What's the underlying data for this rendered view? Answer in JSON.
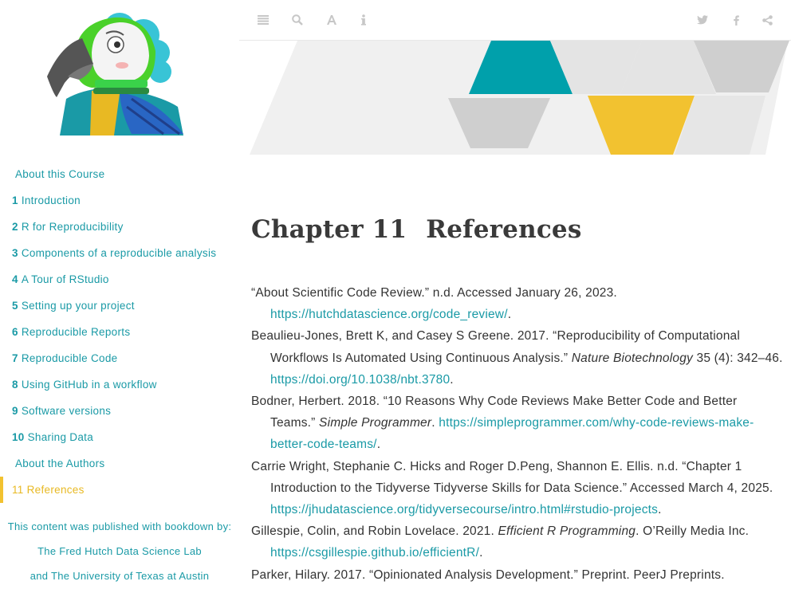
{
  "sidebar": {
    "items": [
      {
        "num": "",
        "label": "About this Course"
      },
      {
        "num": "1",
        "label": "Introduction"
      },
      {
        "num": "2",
        "label": "R for Reproducibility"
      },
      {
        "num": "3",
        "label": "Components of a reproducible analysis"
      },
      {
        "num": "4",
        "label": "A Tour of RStudio"
      },
      {
        "num": "5",
        "label": "Setting up your project"
      },
      {
        "num": "6",
        "label": "Reproducible Reports"
      },
      {
        "num": "7",
        "label": "Reproducible Code"
      },
      {
        "num": "8",
        "label": "Using GitHub in a workflow"
      },
      {
        "num": "9",
        "label": "Software versions"
      },
      {
        "num": "10",
        "label": "Sharing Data"
      },
      {
        "num": "",
        "label": "About the Authors"
      },
      {
        "num": "11",
        "label": "References"
      }
    ],
    "active_index": 12,
    "published": {
      "line1": "This content was published with bookdown by:",
      "line2": "The Fred Hutch Data Science Lab",
      "line3": "and The University of Texas at Austin"
    }
  },
  "toolbar": {
    "left_icons": [
      "toc-toggle-icon",
      "search-icon",
      "font-icon",
      "info-icon"
    ],
    "right_icons": [
      "twitter-icon",
      "facebook-icon",
      "share-icon"
    ]
  },
  "chapter": {
    "number": "Chapter 11",
    "title": "References"
  },
  "references": [
    {
      "text": "“About Scientific Code Review.” n.d. Accessed January 26, 2023. ",
      "italic": "",
      "after": "",
      "link": "https://hutchdatascience.org/code_review/",
      "end": "."
    },
    {
      "text": "Beaulieu-Jones, Brett K, and Casey S Greene. 2017. “Reproducibility of Computational Workflows Is Automated Using Continuous Analysis.” ",
      "italic": "Nature Biotechnology",
      "after": " 35 (4): 342–46. ",
      "link": "https://doi.org/10.1038/nbt.3780",
      "end": "."
    },
    {
      "text": "Bodner, Herbert. 2018. “10 Reasons Why Code Reviews Make Better Code and Better Teams.” ",
      "italic": "Simple Programmer",
      "after": ". ",
      "link": "https://simpleprogrammer.com/why-code-reviews-make-better-code-teams/",
      "end": "."
    },
    {
      "text": "Carrie Wright, Stephanie C. Hicks and Roger D.Peng, Shannon E. Ellis. n.d. “Chapter 1 Introduction to the Tidyverse Tidyverse Skills for Data Science.” Accessed March 4, 2025. ",
      "italic": "",
      "after": "",
      "link": "https://jhudatascience.org/tidyversecourse/intro.html#rstudio-projects",
      "end": "."
    },
    {
      "text": "Gillespie, Colin, and Robin Lovelace. 2021. ",
      "italic": "Efficient R Programming",
      "after": ". O’Reilly Media Inc. ",
      "link": "https://csgillespie.github.io/efficientR/",
      "end": "."
    },
    {
      "text": "Parker, Hilary. 2017. “Opinionated Analysis Development.” Preprint. PeerJ Preprints. ",
      "italic": "",
      "after": "",
      "link": "",
      "end": ""
    }
  ],
  "colors": {
    "accent_teal": "#1a9aa6",
    "accent_yellow": "#f2c230",
    "banner_gray": "#d3d3d3"
  }
}
